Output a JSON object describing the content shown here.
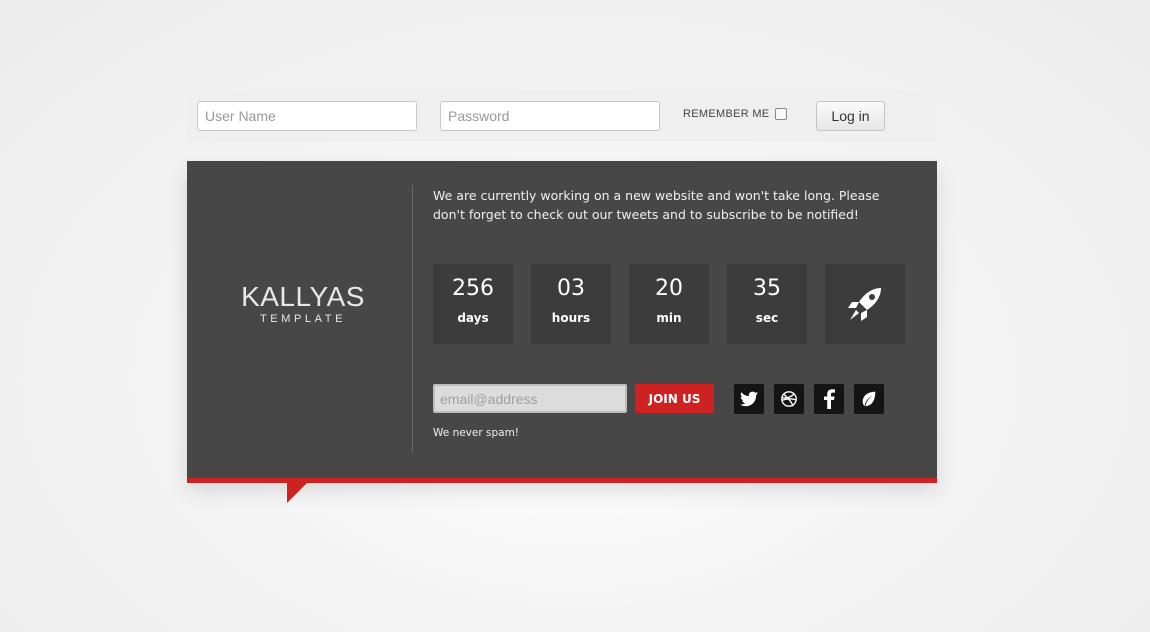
{
  "login": {
    "username_placeholder": "User Name",
    "password_placeholder": "Password",
    "remember_label": "REMEMBER ME",
    "remember_checked": false,
    "login_label": "Log in"
  },
  "brand": {
    "name": "KALLYAS",
    "subtitle": "TEMPLATE"
  },
  "message": "We are currently working on a new website and won't take long. Please don't forget to check out our tweets and to subscribe to be notified!",
  "countdown": [
    {
      "value": "256",
      "unit": "days"
    },
    {
      "value": "03",
      "unit": "hours"
    },
    {
      "value": "20",
      "unit": "min"
    },
    {
      "value": "35",
      "unit": "sec"
    }
  ],
  "subscribe": {
    "email_placeholder": "email@address",
    "join_label": "JOIN US",
    "note": "We never spam!"
  },
  "social": [
    "twitter-icon",
    "dribbble-icon",
    "facebook-icon",
    "leaf-icon"
  ],
  "colors": {
    "accent": "#cd2122",
    "panel": "#474747",
    "box": "#3c3c3c"
  }
}
